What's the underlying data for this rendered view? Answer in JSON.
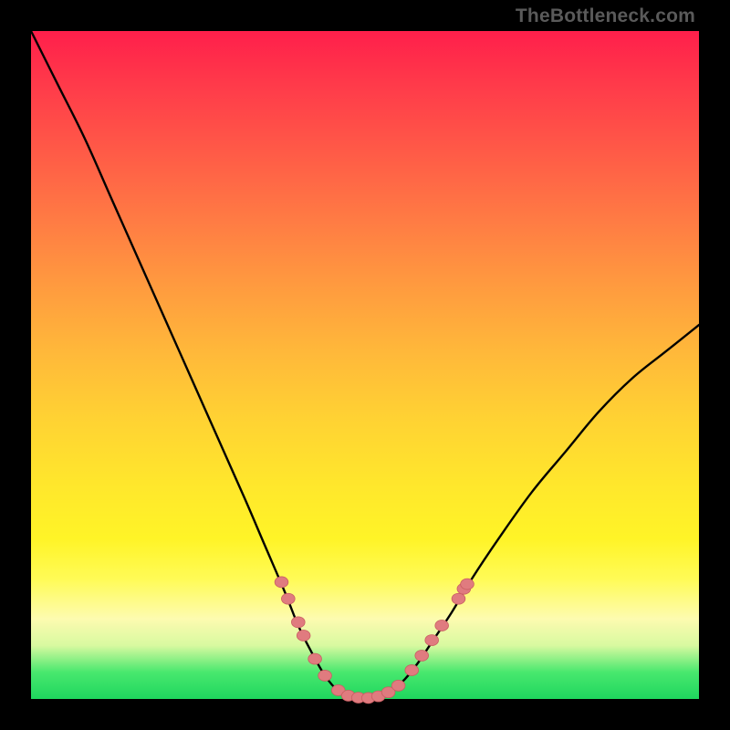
{
  "watermark": "TheBottleneck.com",
  "colors": {
    "curve_stroke": "#000000",
    "marker_fill": "#e07b7f",
    "marker_stroke": "#c95e62",
    "green_band": "#1fd65e"
  },
  "chart_data": {
    "type": "line",
    "title": "",
    "xlabel": "",
    "ylabel": "",
    "xlim": [
      0,
      100
    ],
    "ylim": [
      0,
      100
    ],
    "curve": [
      {
        "x": 0,
        "y": 100
      },
      {
        "x": 4,
        "y": 92
      },
      {
        "x": 8,
        "y": 84
      },
      {
        "x": 12,
        "y": 75
      },
      {
        "x": 16,
        "y": 66
      },
      {
        "x": 20,
        "y": 57
      },
      {
        "x": 24,
        "y": 48
      },
      {
        "x": 28,
        "y": 39
      },
      {
        "x": 32,
        "y": 30
      },
      {
        "x": 35,
        "y": 23
      },
      {
        "x": 38,
        "y": 16
      },
      {
        "x": 40,
        "y": 11
      },
      {
        "x": 42,
        "y": 7
      },
      {
        "x": 44,
        "y": 3.5
      },
      {
        "x": 46,
        "y": 1.2
      },
      {
        "x": 48,
        "y": 0.3
      },
      {
        "x": 50,
        "y": 0
      },
      {
        "x": 52,
        "y": 0.3
      },
      {
        "x": 54,
        "y": 1.2
      },
      {
        "x": 56,
        "y": 3
      },
      {
        "x": 58,
        "y": 5.5
      },
      {
        "x": 60,
        "y": 8.5
      },
      {
        "x": 63,
        "y": 13
      },
      {
        "x": 66,
        "y": 18
      },
      {
        "x": 70,
        "y": 24
      },
      {
        "x": 75,
        "y": 31
      },
      {
        "x": 80,
        "y": 37
      },
      {
        "x": 85,
        "y": 43
      },
      {
        "x": 90,
        "y": 48
      },
      {
        "x": 95,
        "y": 52
      },
      {
        "x": 100,
        "y": 56
      }
    ],
    "markers": [
      {
        "x": 37.5,
        "y": 17.5
      },
      {
        "x": 38.5,
        "y": 15
      },
      {
        "x": 40,
        "y": 11.5
      },
      {
        "x": 40.8,
        "y": 9.5
      },
      {
        "x": 42.5,
        "y": 6
      },
      {
        "x": 44,
        "y": 3.5
      },
      {
        "x": 46,
        "y": 1.3
      },
      {
        "x": 47.5,
        "y": 0.5
      },
      {
        "x": 49,
        "y": 0.2
      },
      {
        "x": 50.5,
        "y": 0.15
      },
      {
        "x": 52,
        "y": 0.4
      },
      {
        "x": 53.5,
        "y": 1
      },
      {
        "x": 55,
        "y": 2
      },
      {
        "x": 57,
        "y": 4.3
      },
      {
        "x": 58.5,
        "y": 6.5
      },
      {
        "x": 60,
        "y": 8.8
      },
      {
        "x": 61.5,
        "y": 11
      },
      {
        "x": 64,
        "y": 15
      },
      {
        "x": 64.8,
        "y": 16.5
      },
      {
        "x": 65.3,
        "y": 17.2
      }
    ],
    "marker_radius_px": 7
  }
}
